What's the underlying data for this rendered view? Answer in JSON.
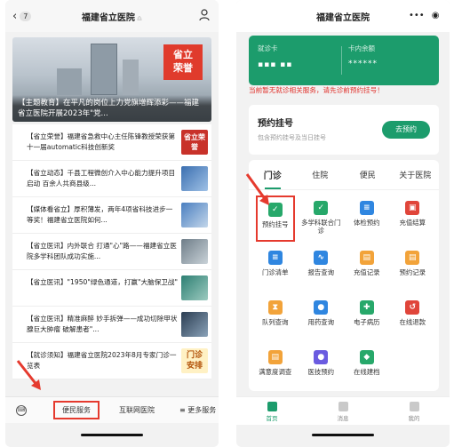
{
  "left": {
    "header": {
      "back_badge": "7",
      "title": "福建省立医院",
      "title_mark": "♎"
    },
    "hero": {
      "stamp": "省立\n荣誉",
      "caption": "【主题教育】在平凡的岗位上力党旗增辉添彩——福建省立医院开展2023年\"党..."
    },
    "news": [
      {
        "text": "【省立荣誉】福建省急救中心主任陈锋教授荣获第十一届automatic科技创新奖",
        "thumb": "red",
        "thumb_text": "省立荣誉"
      },
      {
        "text": "【省立动态】千县工程微创介入中心能力提升项目启动 百余人共商县级...",
        "thumb": "blue",
        "thumb_text": ""
      },
      {
        "text": "【媒体看省立】厚积薄发，两年4项省科技进步一等奖！福建省立医院如何...",
        "thumb": "sky",
        "thumb_text": ""
      },
      {
        "text": "【省立医讯】内外联合 打通\"心\"路——福建省立医院多学科团队成功实施...",
        "thumb": "gray",
        "thumb_text": ""
      },
      {
        "text": "【省立医讯】\"1950\"绿色通道，打赢\"大脑保卫战\"",
        "thumb": "teal",
        "thumb_text": ""
      },
      {
        "text": "【省立医讯】精准麻醉 妙手拆弹——成功切除甲状腺巨大肿瘤 破解患者\"...",
        "thumb": "dark",
        "thumb_text": ""
      },
      {
        "text": "【就诊须知】福建省立医院2023年8月专家门诊一览表",
        "thumb": "yellow",
        "thumb_text": "门诊\n安排"
      }
    ],
    "tabbar": {
      "kbd": "⌨",
      "tab1": "便民服务",
      "tab2": "互联网医院",
      "tab3": "≡ 更多服务"
    }
  },
  "right": {
    "header": {
      "title": "福建省立医院",
      "menu_dots": "•••",
      "menu_target": "◉"
    },
    "card": {
      "label1": "就诊卡",
      "value1": "▪▪▪ ▪▪",
      "label2": "卡内余额",
      "value2": "******"
    },
    "warning": "当前暂无就诊相关服务，请先诊前预约挂号！",
    "booking": {
      "title": "预约挂号",
      "subtitle": "包含预约挂号及当日挂号",
      "button": "去预约"
    },
    "tabs": [
      "门诊",
      "住院",
      "便民",
      "关于医院"
    ],
    "services": [
      {
        "label": "预约挂号",
        "color": "#27a86a",
        "glyph": "✓",
        "highlight": true
      },
      {
        "label": "多学科联合门诊",
        "color": "#27a86a",
        "glyph": "✓",
        "highlight": false
      },
      {
        "label": "体检预约",
        "color": "#2f86e0",
        "glyph": "≡",
        "highlight": false
      },
      {
        "label": "充值结算",
        "color": "#e0453a",
        "glyph": "▣",
        "highlight": false
      },
      {
        "label": "门诊清单",
        "color": "#2f86e0",
        "glyph": "≡",
        "highlight": false
      },
      {
        "label": "报告查询",
        "color": "#2f86e0",
        "glyph": "∿",
        "highlight": false
      },
      {
        "label": "充值记录",
        "color": "#f2a33a",
        "glyph": "▤",
        "highlight": false
      },
      {
        "label": "预约记录",
        "color": "#f2a33a",
        "glyph": "▤",
        "highlight": false
      },
      {
        "label": "队列查询",
        "color": "#f2a33a",
        "glyph": "⧗",
        "highlight": false
      },
      {
        "label": "用药查询",
        "color": "#2f86e0",
        "glyph": "●",
        "highlight": false
      },
      {
        "label": "电子病历",
        "color": "#27a86a",
        "glyph": "✚",
        "highlight": false
      },
      {
        "label": "在线退款",
        "color": "#e0453a",
        "glyph": "↺",
        "highlight": false
      },
      {
        "label": "满意度调查",
        "color": "#f2a33a",
        "glyph": "▤",
        "highlight": false
      },
      {
        "label": "医技预约",
        "color": "#6a5be0",
        "glyph": "●",
        "highlight": false
      },
      {
        "label": "在线建档",
        "color": "#27a86a",
        "glyph": "◆",
        "highlight": false
      }
    ],
    "bottom": [
      {
        "label": "首页",
        "active": true
      },
      {
        "label": "消息",
        "active": false
      },
      {
        "label": "我的",
        "active": false
      }
    ]
  },
  "accent_color": "#1c9c6c",
  "highlight_color": "#e53a2e"
}
